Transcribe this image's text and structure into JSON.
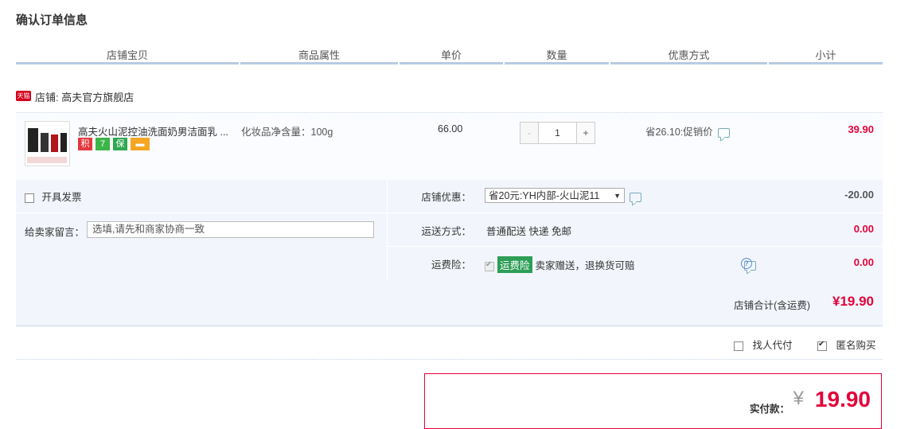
{
  "page": {
    "title": "确认订单信息"
  },
  "columns": [
    "店铺宝贝",
    "商品属性",
    "单价",
    "数量",
    "优惠方式",
    "小计"
  ],
  "shop": {
    "badge": "天猫",
    "label": "店铺: 高夫官方旗舰店"
  },
  "item": {
    "name": "高夫火山泥控油洗面奶男洁面乳 ...",
    "attribute": "化妆品净含量：100g",
    "price": "66.00",
    "quantity": "1",
    "minus": "-",
    "plus": "+",
    "promotion": "省26.10:促销价",
    "subtotal": "39.90",
    "badges": [
      {
        "text": "积",
        "color": "#e4393c"
      },
      {
        "text": "7",
        "color": "#3bb54a"
      },
      {
        "text": "保",
        "color": "#2ea84f"
      },
      {
        "text": "▬",
        "color": "#f5a623"
      }
    ]
  },
  "options": {
    "invoice_label": "开具发票",
    "message_label": "给卖家留言：",
    "message_placeholder": "选填,请先和商家协商一致",
    "shop_discount_label": "店铺优惠：",
    "shop_discount_value": "省20元:YH内部-火山泥11",
    "shop_discount_amount": "-20.00",
    "shipping_label": "运送方式：",
    "shipping_value": "普通配送 快递 免邮",
    "shipping_amount": "0.00",
    "insurance_label": "运费险：",
    "insurance_tag": "运费险",
    "insurance_text": "卖家赠送，退换货可赔",
    "insurance_amount": "0.00"
  },
  "total": {
    "label": "店铺合计(含运费)",
    "amount": "¥19.90"
  },
  "bottom": {
    "proxy_pay": "找人代付",
    "anonymous": "匿名购买"
  },
  "final": {
    "label": "实付款：",
    "currency": "¥",
    "amount": "19.90"
  },
  "colors": {
    "accent": "#e4003a",
    "header_bar": "#b8cbe2",
    "panel": "#f2f6fc"
  }
}
